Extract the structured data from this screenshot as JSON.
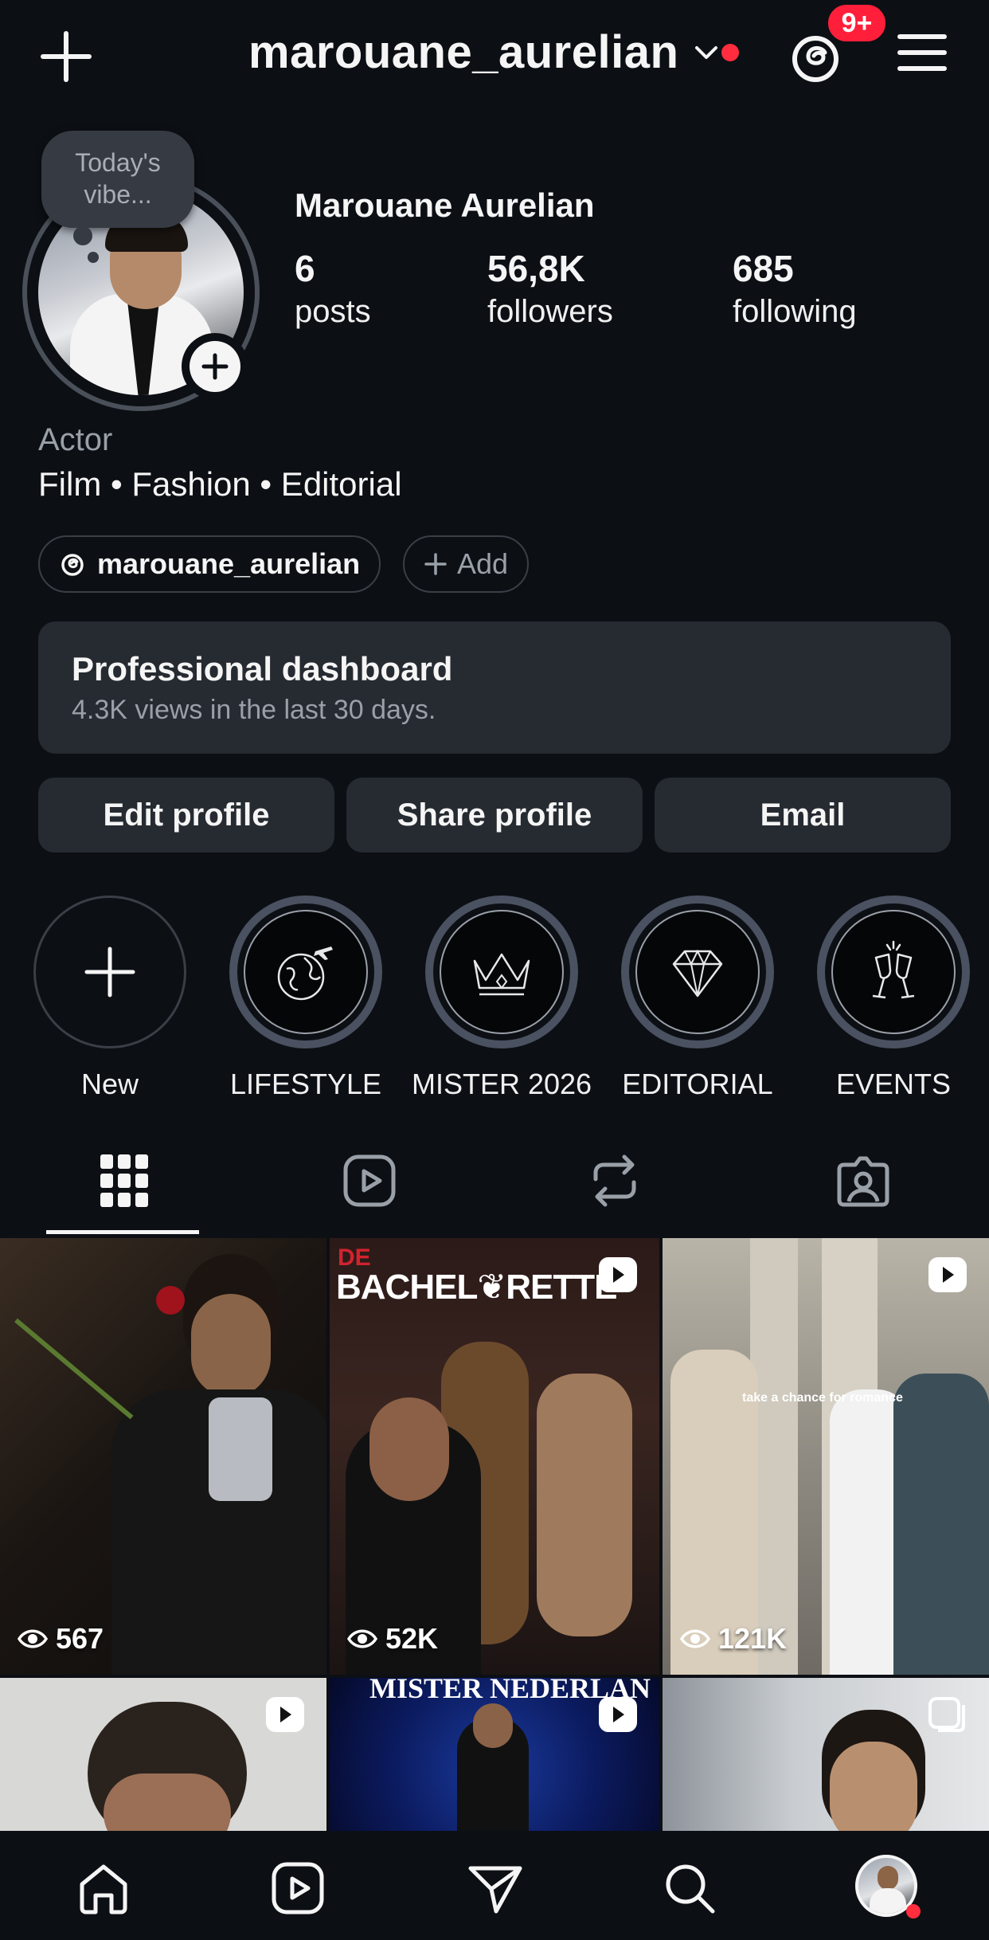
{
  "header": {
    "username": "marouane_aurelian",
    "notification_badge": "9+"
  },
  "profile": {
    "note": "Today's vibe...",
    "display_name": "Marouane Aurelian",
    "stats": [
      {
        "value": "6",
        "label": "posts"
      },
      {
        "value": "56,8K",
        "label": "followers"
      },
      {
        "value": "685",
        "label": "following"
      }
    ],
    "category": "Actor",
    "bio": "Film • Fashion • Editorial",
    "threads_handle": "marouane_aurelian",
    "add_label": "Add"
  },
  "dashboard": {
    "title": "Professional dashboard",
    "subtitle": "4.3K views in the last 30 days."
  },
  "actions": {
    "edit": "Edit profile",
    "share": "Share profile",
    "email": "Email"
  },
  "highlights": [
    {
      "label": "New",
      "icon": "plus-icon"
    },
    {
      "label": "LIFESTYLE",
      "icon": "globe-plane-icon"
    },
    {
      "label": "MISTER 2026",
      "icon": "crown-icon"
    },
    {
      "label": "EDITORIAL",
      "icon": "diamond-icon"
    },
    {
      "label": "EVENTS",
      "icon": "champagne-icon"
    }
  ],
  "tabs": [
    "grid-icon",
    "reels-icon",
    "reposts-icon",
    "tagged-icon"
  ],
  "posts": [
    {
      "views": "567",
      "type": "image"
    },
    {
      "views": "52K",
      "type": "reel",
      "overlay_text": "BACHEL❦RETTE",
      "overlay_small": "DE"
    },
    {
      "views": "121K",
      "type": "reel",
      "overlay_text": "take a chance for romance"
    },
    {
      "type": "reel"
    },
    {
      "type": "reel",
      "overlay_text": "MISTER NEDERLAN"
    },
    {
      "type": "carousel"
    }
  ],
  "colors": {
    "background": "#0c0f14",
    "surface": "#262a31",
    "accent_red": "#ff2d3d",
    "muted_text": "#9aa0a8"
  }
}
